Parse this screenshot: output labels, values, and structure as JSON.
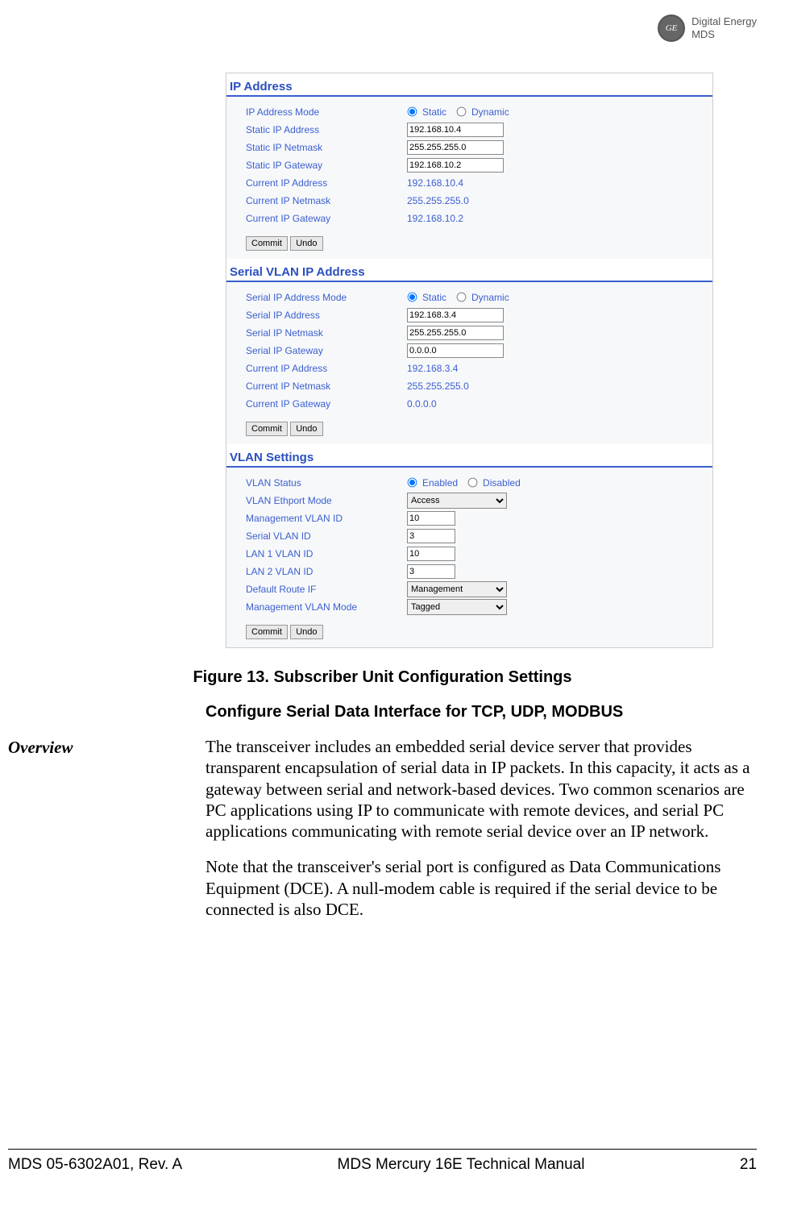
{
  "brand": {
    "line1": "Digital Energy",
    "line2": "MDS"
  },
  "sections": {
    "ip": {
      "title": "IP Address",
      "rows": {
        "mode_label": "IP Address Mode",
        "mode_opt1": "Static",
        "mode_opt2": "Dynamic",
        "static_ip_label": "Static IP Address",
        "static_ip_value": "192.168.10.4",
        "static_netmask_label": "Static IP Netmask",
        "static_netmask_value": "255.255.255.0",
        "static_gateway_label": "Static IP Gateway",
        "static_gateway_value": "192.168.10.2",
        "cur_ip_label": "Current IP Address",
        "cur_ip_value": "192.168.10.4",
        "cur_netmask_label": "Current IP Netmask",
        "cur_netmask_value": "255.255.255.0",
        "cur_gateway_label": "Current IP Gateway",
        "cur_gateway_value": "192.168.10.2"
      }
    },
    "serial": {
      "title": "Serial VLAN IP Address",
      "rows": {
        "mode_label": "Serial IP Address Mode",
        "mode_opt1": "Static",
        "mode_opt2": "Dynamic",
        "ip_label": "Serial IP Address",
        "ip_value": "192.168.3.4",
        "netmask_label": "Serial IP Netmask",
        "netmask_value": "255.255.255.0",
        "gateway_label": "Serial IP Gateway",
        "gateway_value": "0.0.0.0",
        "cur_ip_label": "Current IP Address",
        "cur_ip_value": "192.168.3.4",
        "cur_netmask_label": "Current IP Netmask",
        "cur_netmask_value": "255.255.255.0",
        "cur_gateway_label": "Current IP Gateway",
        "cur_gateway_value": "0.0.0.0"
      }
    },
    "vlan": {
      "title": "VLAN Settings",
      "rows": {
        "status_label": "VLAN Status",
        "status_opt1": "Enabled",
        "status_opt2": "Disabled",
        "ethport_label": "VLAN Ethport Mode",
        "ethport_value": "Access",
        "mgmt_id_label": "Management VLAN ID",
        "mgmt_id_value": "10",
        "serial_id_label": "Serial VLAN ID",
        "serial_id_value": "3",
        "lan1_label": "LAN 1 VLAN ID",
        "lan1_value": "10",
        "lan2_label": "LAN 2 VLAN ID",
        "lan2_value": "3",
        "route_label": "Default Route IF",
        "route_value": "Management",
        "mgmt_mode_label": "Management VLAN Mode",
        "mgmt_mode_value": "Tagged"
      }
    }
  },
  "buttons": {
    "commit": "Commit",
    "undo": "Undo"
  },
  "figure_caption": "Figure 13. Subscriber Unit Configuration Settings",
  "body_heading": "Configure Serial Data Interface for TCP, UDP, MODBUS",
  "overview_label": "Overview",
  "para1": "The transceiver includes an embedded serial device server that provides transparent encapsulation of serial data in IP packets. In this capacity, it acts as a gateway between serial and network-based devices. Two common scenarios are PC applications using IP to communicate with remote devices, and serial PC applications communicating with remote serial device over an IP network.",
  "para2": "Note that the transceiver's serial port is configured as Data Communications Equipment (DCE). A null-modem cable is required if the serial device to be connected is also DCE.",
  "footer": {
    "left": "MDS 05-6302A01, Rev.  A",
    "center": "MDS Mercury 16E Technical Manual",
    "right": "21"
  }
}
